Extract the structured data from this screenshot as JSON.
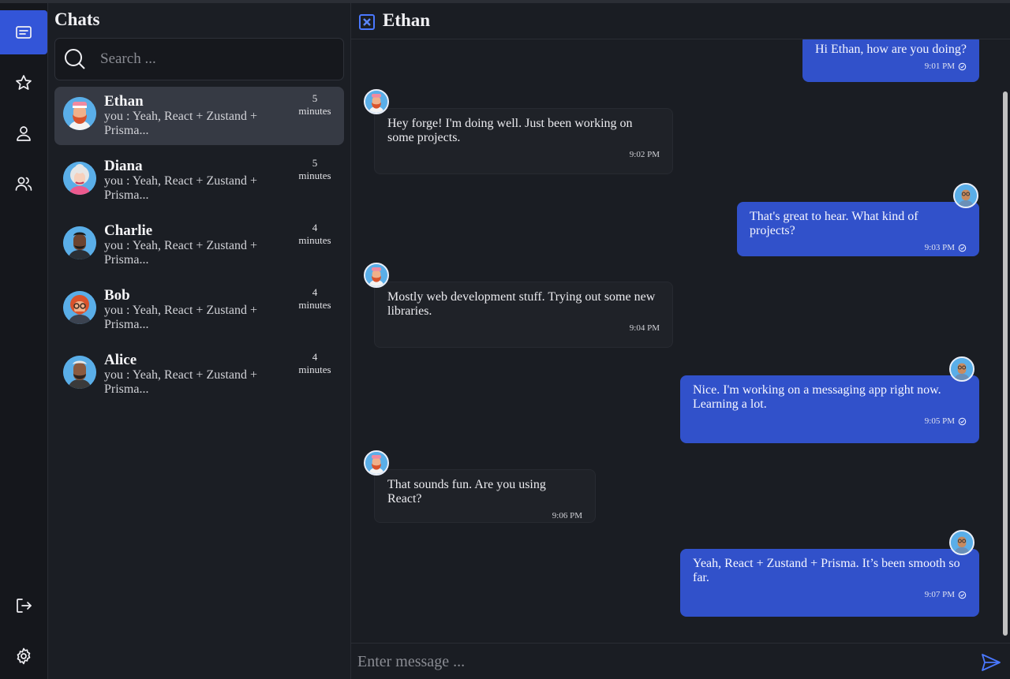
{
  "panel": {
    "title": "Chats",
    "search_placeholder": "Search ..."
  },
  "chats": [
    {
      "name": "Ethan",
      "preview": "you : Yeah, React + Zustand + Prisma...",
      "time_num": "5",
      "time_unit": "minutes",
      "avatar": "ethan"
    },
    {
      "name": "Diana",
      "preview": "you : Yeah, React + Zustand + Prisma...",
      "time_num": "5",
      "time_unit": "minutes",
      "avatar": "diana"
    },
    {
      "name": "Charlie",
      "preview": "you : Yeah, React + Zustand + Prisma...",
      "time_num": "4",
      "time_unit": "minutes",
      "avatar": "charlie"
    },
    {
      "name": "Bob",
      "preview": "you : Yeah, React + Zustand + Prisma...",
      "time_num": "4",
      "time_unit": "minutes",
      "avatar": "bob"
    },
    {
      "name": "Alice",
      "preview": "you : Yeah, React + Zustand + Prisma...",
      "time_num": "4",
      "time_unit": "minutes",
      "avatar": "alice"
    }
  ],
  "conversation": {
    "title": "Ethan",
    "input_placeholder": "Enter message ...",
    "messages": [
      {
        "direction": "out",
        "text": "Hi Ethan, how are you doing?",
        "time": "9:01 PM"
      },
      {
        "direction": "in",
        "text": "Hey forge! I'm doing well. Just been working on some projects.",
        "time": "9:02 PM"
      },
      {
        "direction": "out",
        "text": "That's great to hear. What kind of projects?",
        "time": "9:03 PM"
      },
      {
        "direction": "in",
        "text": "Mostly web development stuff. Trying out some new libraries.",
        "time": "9:04 PM"
      },
      {
        "direction": "out",
        "text": "Nice. I'm working on a messaging app right now. Learning a lot.",
        "time": "9:05 PM"
      },
      {
        "direction": "in",
        "text": "That sounds fun. Are you using React?",
        "time": "9:06 PM"
      },
      {
        "direction": "out",
        "text": "Yeah, React + Zustand + Prisma. It’s been smooth so far.",
        "time": "9:07 PM"
      }
    ]
  },
  "icons": {
    "rail_top": [
      "chat-icon",
      "star-icon",
      "user-icon",
      "users-icon"
    ],
    "rail_bottom": [
      "logout-icon",
      "settings-icon"
    ]
  },
  "colors": {
    "accent": "#3355d8",
    "bubble_out": "#3151ca",
    "bubble_in": "#1f2228",
    "background": "#1a1d23"
  }
}
